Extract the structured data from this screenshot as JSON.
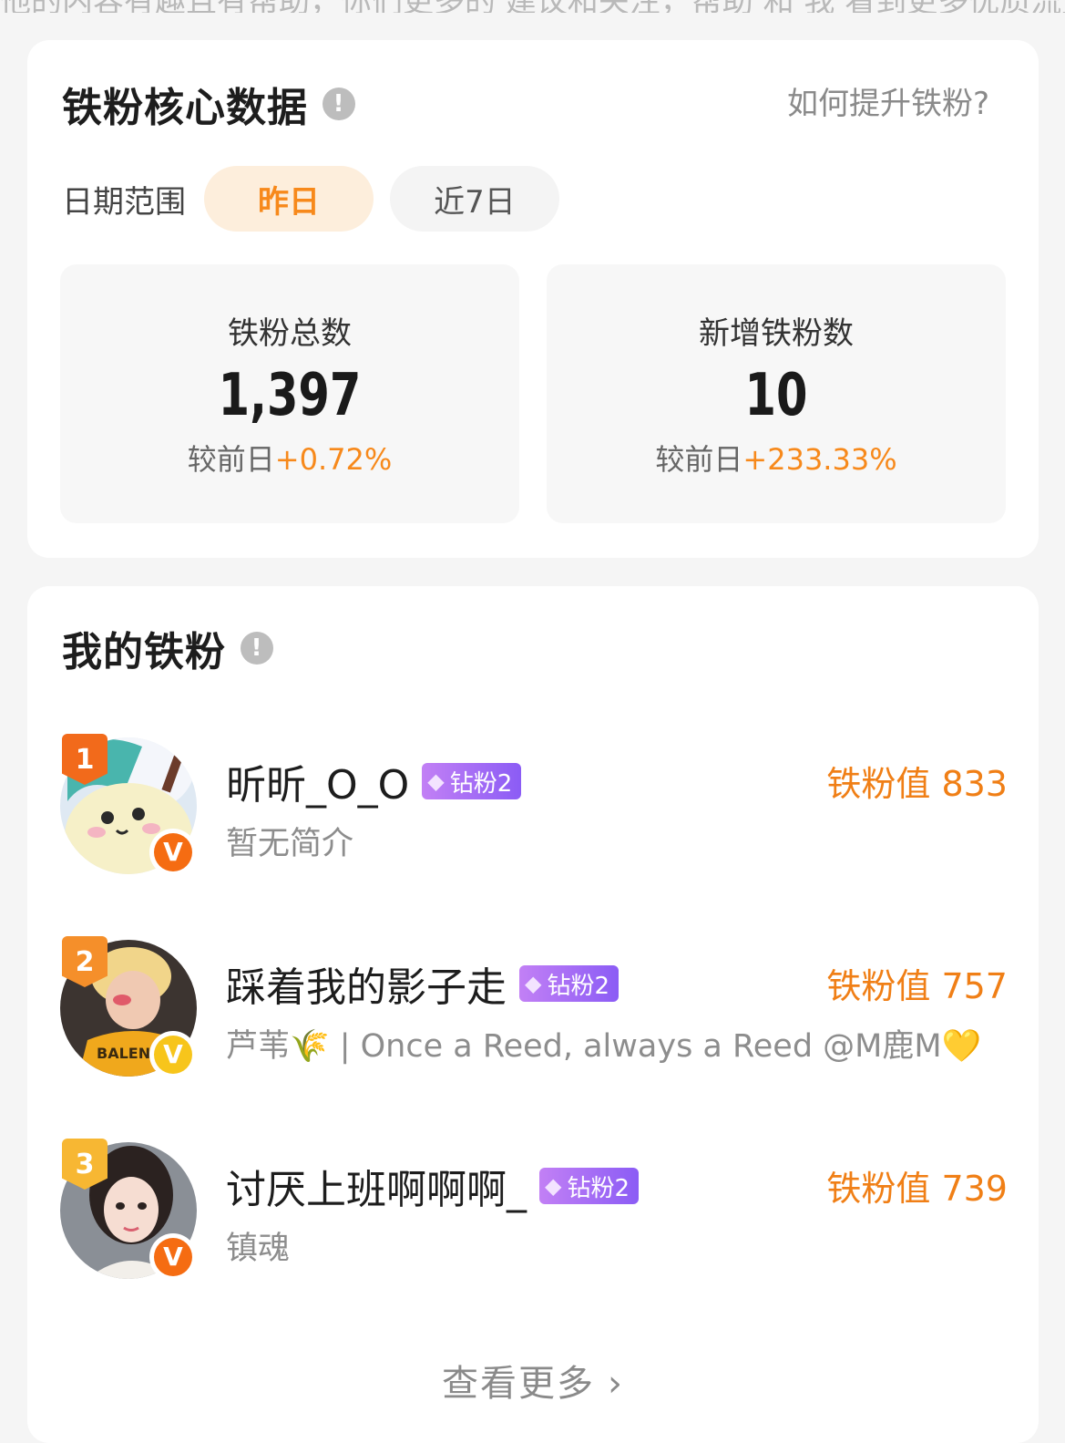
{
  "top_cut_text": "他的内容有趣且有帮助，你们更多的 建议和关注，帮助 和 我 看到更多优质流量",
  "core": {
    "title": "铁粉核心数据",
    "info_icon": "!",
    "help_link": "如何提升铁粉?",
    "date_label": "日期范围",
    "range_options": [
      "昨日",
      "近7日"
    ],
    "selected_range": "昨日",
    "stats": [
      {
        "label": "铁粉总数",
        "value": "1,397",
        "compare_prefix": "较前日",
        "compare_value": "+0.72%"
      },
      {
        "label": "新增铁粉数",
        "value": "10",
        "compare_prefix": "较前日",
        "compare_value": "+233.33%"
      }
    ]
  },
  "fans": {
    "title": "我的铁粉",
    "info_icon": "!",
    "items": [
      {
        "rank": "1",
        "name": "昕昕_O_O",
        "level": "钻粉2",
        "score": "铁粉值 833",
        "bio": "暂无简介",
        "verified": "V"
      },
      {
        "rank": "2",
        "name": "踩着我的影子走",
        "level": "钻粉2",
        "score": "铁粉值 757",
        "bio": "芦苇🌾 | Once a Reed, always a Reed @M鹿M💛",
        "verified": "V"
      },
      {
        "rank": "3",
        "name": "讨厌上班啊啊啊_",
        "level": "钻粉2",
        "score": "铁粉值 739",
        "bio": "镇魂",
        "verified": "V"
      }
    ],
    "more_label": "查看更多",
    "more_icon": "chevron-right-icon"
  },
  "colors": {
    "accent": "#f7891b",
    "level_tag": "#a36bf5",
    "page_bg": "#f5f5f5"
  }
}
